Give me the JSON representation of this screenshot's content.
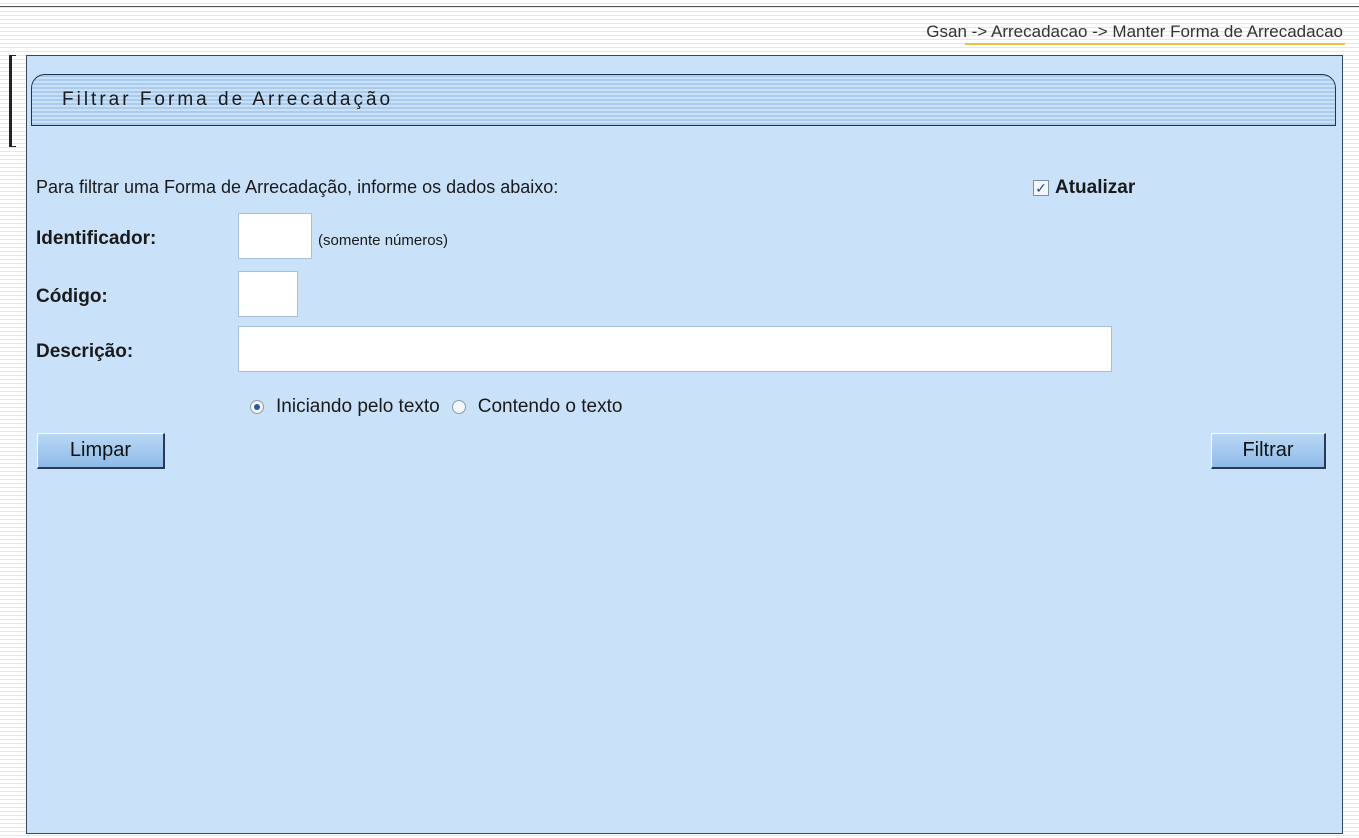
{
  "breadcrumb": "Gsan -> Arrecadacao -> Manter Forma de Arrecadacao",
  "panel": {
    "title": "Filtrar Forma de Arrecadação"
  },
  "form": {
    "intro": "Para filtrar uma Forma de Arrecadação, informe os dados abaixo:",
    "atualizar": {
      "label": "Atualizar",
      "checked": true
    },
    "identificador": {
      "label": "Identificador:",
      "value": "",
      "hint": "(somente números)"
    },
    "codigo": {
      "label": "Código:",
      "value": ""
    },
    "descricao": {
      "label": "Descrição:",
      "value": ""
    },
    "search_mode": {
      "options": [
        "Iniciando pelo texto",
        "Contendo o texto"
      ],
      "selected": "Iniciando pelo texto"
    }
  },
  "buttons": {
    "clear_label": "Limpar",
    "filter_label": "Filtrar"
  },
  "icons": {
    "checkbox": "checkbox-checked-icon",
    "radio_selected": "radio-selected-icon",
    "radio_unselected": "radio-unselected-icon"
  }
}
